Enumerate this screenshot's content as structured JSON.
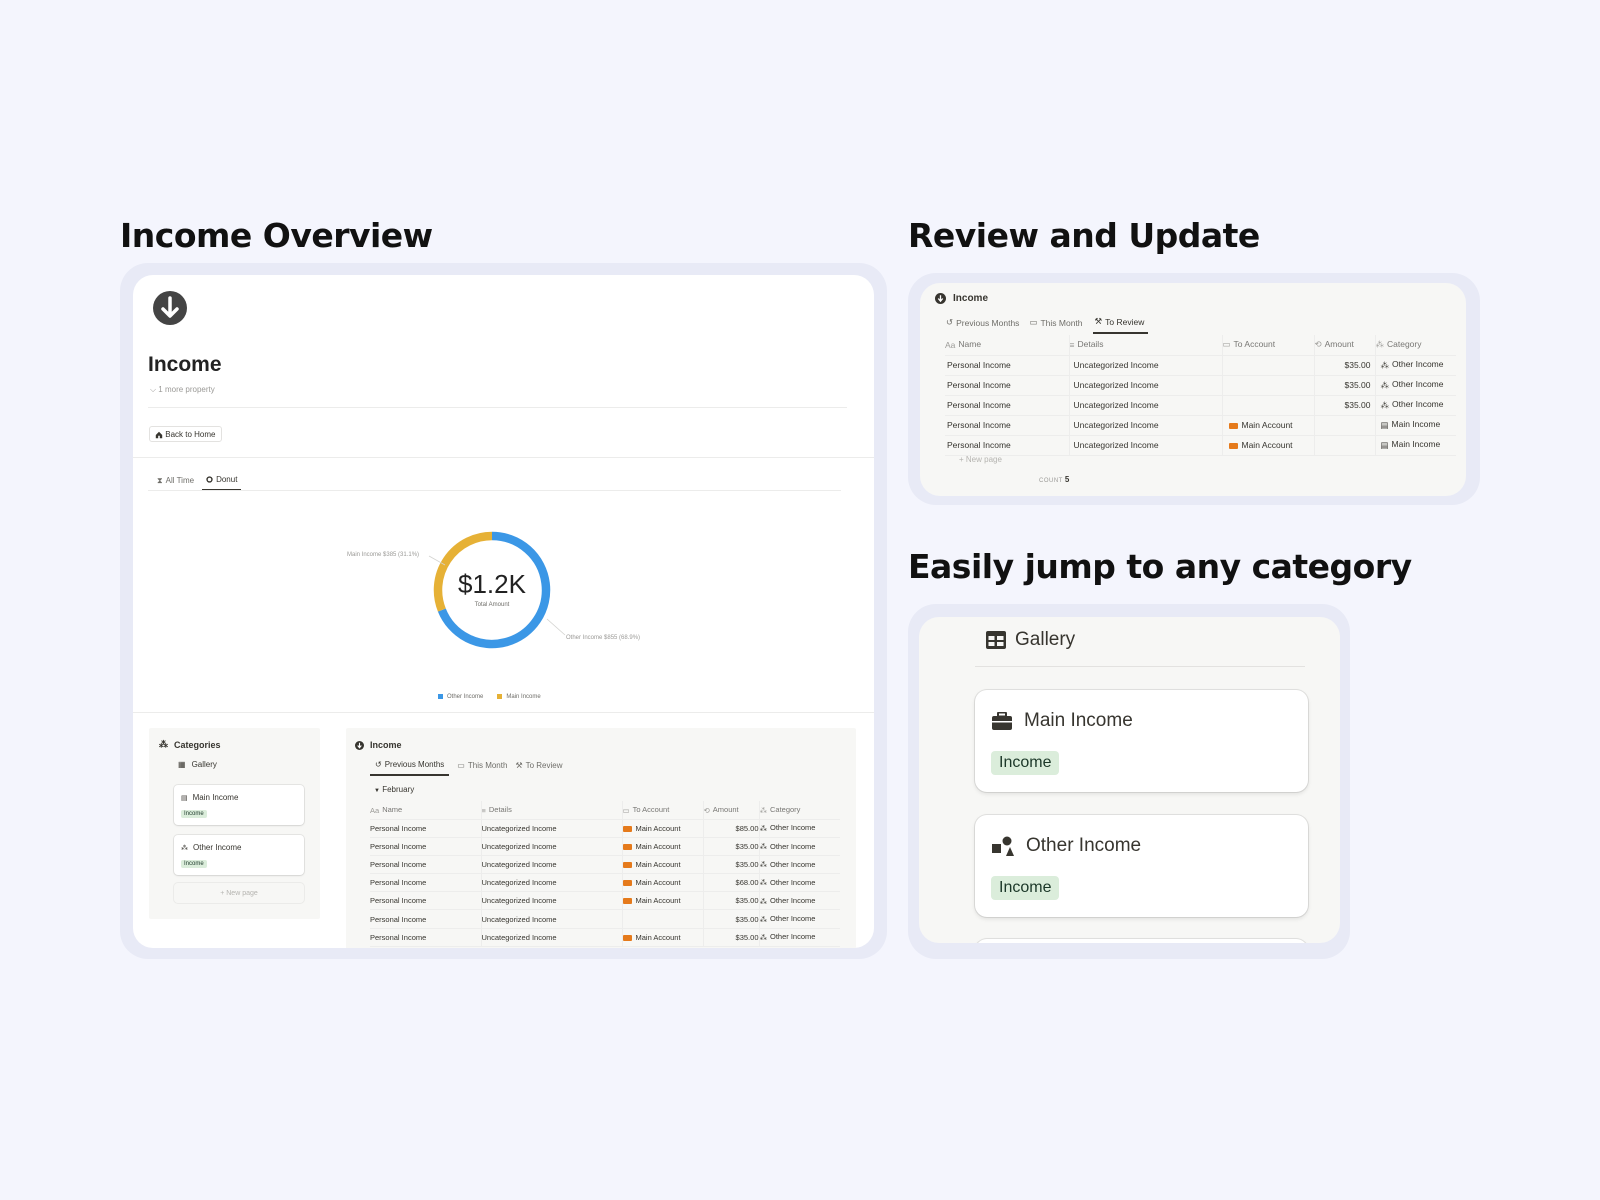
{
  "sections": {
    "overview_title": "Income Overview",
    "review_title": "Review and Update",
    "category_title": "Easily jump to any category"
  },
  "overview": {
    "page_title": "Income",
    "more_property": "1 more property",
    "back_button": "Back to Home",
    "view_tabs": [
      {
        "label": "All Time",
        "icon": "hourglass-icon",
        "active": false
      },
      {
        "label": "Donut",
        "icon": "donut-icon",
        "active": true
      }
    ],
    "donut": {
      "center_value": "$1.2K",
      "center_label": "Total Amount",
      "callout_main": "Main Income $385 (31.1%)",
      "callout_other": "Other Income $855 (68.9%)",
      "legend": [
        "Other Income",
        "Main Income"
      ]
    },
    "categories": {
      "title": "Categories",
      "view": "Gallery",
      "cards": [
        {
          "title": "Main Income",
          "tag": "Income",
          "icon": "briefcase-icon"
        },
        {
          "title": "Other Income",
          "tag": "Income",
          "icon": "shapes-icon"
        }
      ],
      "new_page": "+ New page"
    },
    "income_table": {
      "title": "Income",
      "tabs": [
        {
          "label": "Previous Months",
          "icon": "history-icon",
          "active": true
        },
        {
          "label": "This Month",
          "icon": "calendar-icon",
          "active": false
        },
        {
          "label": "To Review",
          "icon": "wrench-icon",
          "active": false
        }
      ],
      "group": "February",
      "columns": [
        "Name",
        "Details",
        "To Account",
        "Amount",
        "Category"
      ],
      "rows": [
        {
          "name": "Personal Income",
          "details": "Uncategorized Income",
          "account": "Main Account",
          "amount": "$85.00",
          "category": "Other Income"
        },
        {
          "name": "Personal Income",
          "details": "Uncategorized Income",
          "account": "Main Account",
          "amount": "$35.00",
          "category": "Other Income"
        },
        {
          "name": "Personal Income",
          "details": "Uncategorized Income",
          "account": "Main Account",
          "amount": "$35.00",
          "category": "Other Income"
        },
        {
          "name": "Personal Income",
          "details": "Uncategorized Income",
          "account": "Main Account",
          "amount": "$68.00",
          "category": "Other Income"
        },
        {
          "name": "Personal Income",
          "details": "Uncategorized Income",
          "account": "Main Account",
          "amount": "$35.00",
          "category": "Other Income"
        },
        {
          "name": "Personal Income",
          "details": "Uncategorized Income",
          "account": "",
          "amount": "$35.00",
          "category": "Other Income"
        },
        {
          "name": "Personal Income",
          "details": "Uncategorized Income",
          "account": "Main Account",
          "amount": "$35.00",
          "category": "Other Income"
        }
      ]
    }
  },
  "review": {
    "title": "Income",
    "tabs": [
      {
        "label": "Previous Months",
        "icon": "history-icon",
        "active": false
      },
      {
        "label": "This Month",
        "icon": "calendar-icon",
        "active": false
      },
      {
        "label": "To Review",
        "icon": "wrench-icon",
        "active": true
      }
    ],
    "columns": [
      "Name",
      "Details",
      "To Account",
      "Amount",
      "Category"
    ],
    "rows": [
      {
        "name": "Personal Income",
        "details": "Uncategorized Income",
        "account": "",
        "amount": "$35.00",
        "category": "Other Income",
        "cat_icon": "shapes-icon"
      },
      {
        "name": "Personal Income",
        "details": "Uncategorized Income",
        "account": "",
        "amount": "$35.00",
        "category": "Other Income",
        "cat_icon": "shapes-icon"
      },
      {
        "name": "Personal Income",
        "details": "Uncategorized Income",
        "account": "",
        "amount": "$35.00",
        "category": "Other Income",
        "cat_icon": "shapes-icon"
      },
      {
        "name": "Personal Income",
        "details": "Uncategorized Income",
        "account": "Main Account",
        "amount": "",
        "category": "Main Income",
        "cat_icon": "briefcase-icon"
      },
      {
        "name": "Personal Income",
        "details": "Uncategorized Income",
        "account": "Main Account",
        "amount": "",
        "category": "Main Income",
        "cat_icon": "briefcase-icon"
      }
    ],
    "new_page": "+ New page",
    "count_label": "COUNT",
    "count_value": "5"
  },
  "gallery": {
    "title": "Gallery",
    "cards": [
      {
        "title": "Main Income",
        "tag": "Income",
        "icon": "briefcase-icon"
      },
      {
        "title": "Other Income",
        "tag": "Income",
        "icon": "shapes-icon"
      }
    ]
  },
  "colors": {
    "background": "#f4f5fd",
    "frame": "#e8eaf6",
    "other_income": "#3b97e6",
    "main_income": "#e6b136",
    "account_icon": "#e57a1b",
    "tag_bg": "#dbeddb"
  },
  "chart_data": {
    "type": "pie",
    "title": "",
    "series": [
      {
        "values": [
          855,
          385
        ]
      }
    ],
    "categories": [
      "Other Income",
      "Main Income"
    ],
    "percentages": [
      68.9,
      31.1
    ],
    "center_value": "$1.2K",
    "center_label": "Total Amount"
  }
}
